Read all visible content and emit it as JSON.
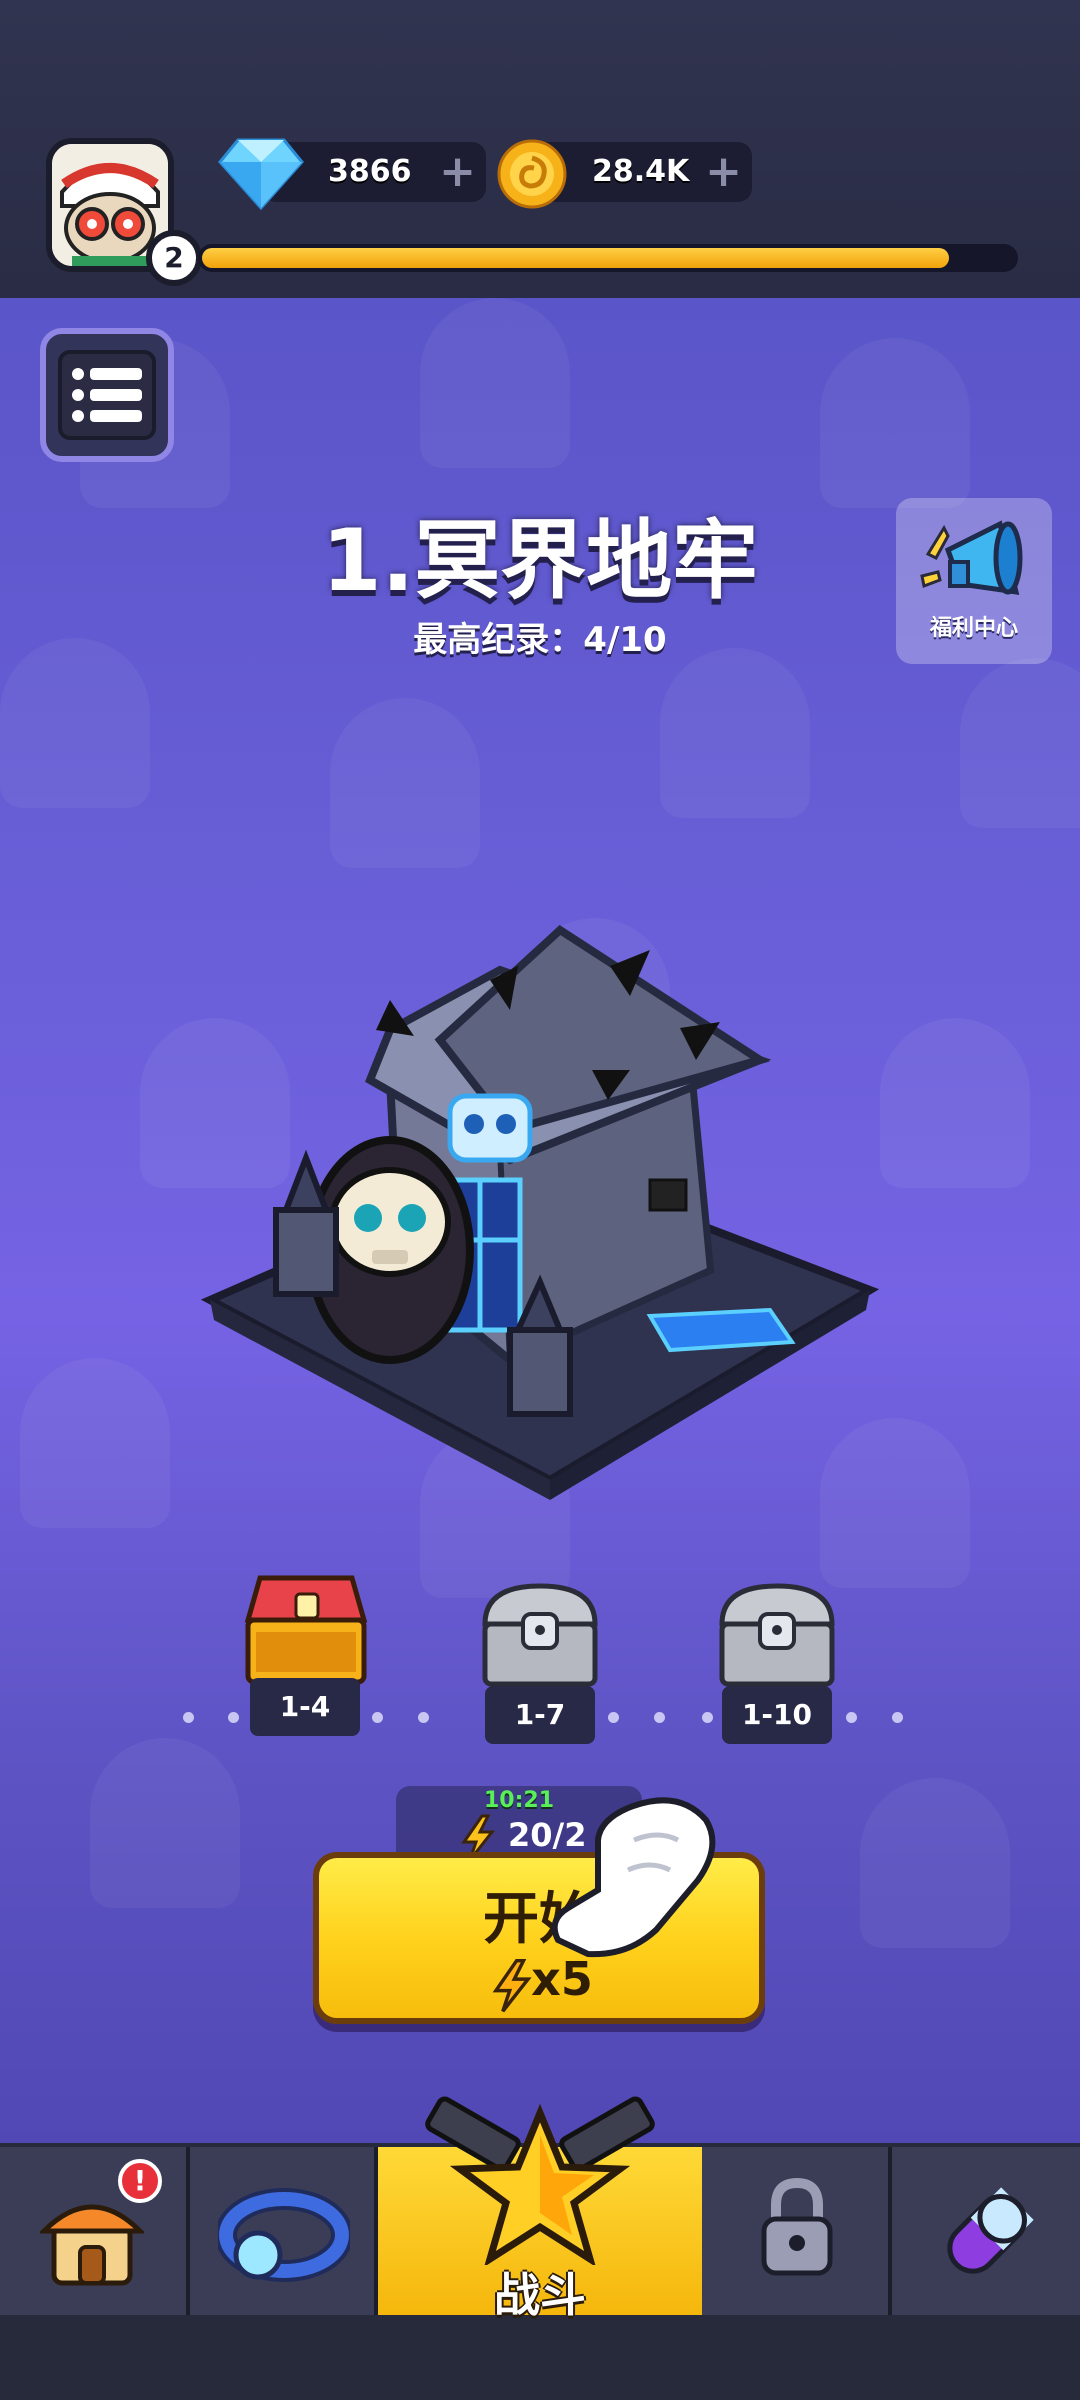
{
  "header": {
    "player_level": "2",
    "xp_progress": 0.92,
    "gems": {
      "value": "3866",
      "icon": "diamond-icon",
      "plus": "+"
    },
    "coins": {
      "value": "28.4K",
      "icon": "coin-icon",
      "plus": "+"
    }
  },
  "stage": {
    "title": "1.冥界地牢",
    "best_record": "最高纪录：4/10"
  },
  "welfare": {
    "label": "福利中心",
    "icon": "megaphone-icon"
  },
  "chests": [
    {
      "label": "1-4",
      "state": "open-gold"
    },
    {
      "label": "1-7",
      "state": "locked-silver"
    },
    {
      "label": "1-10",
      "state": "locked-silver"
    }
  ],
  "energy": {
    "timer": "10:21",
    "count": "20/2"
  },
  "start_button": {
    "label": "开始",
    "cost": "x5"
  },
  "bottom_nav": {
    "tabs": [
      "shop",
      "equipment",
      "battle",
      "locked",
      "talent"
    ],
    "battle_label": "战斗",
    "shop_badge": "!"
  },
  "colors": {
    "accent_yellow": "#ffd21d",
    "bg_purple": "#6a5fd8",
    "bar_dark": "#2c2e49"
  }
}
